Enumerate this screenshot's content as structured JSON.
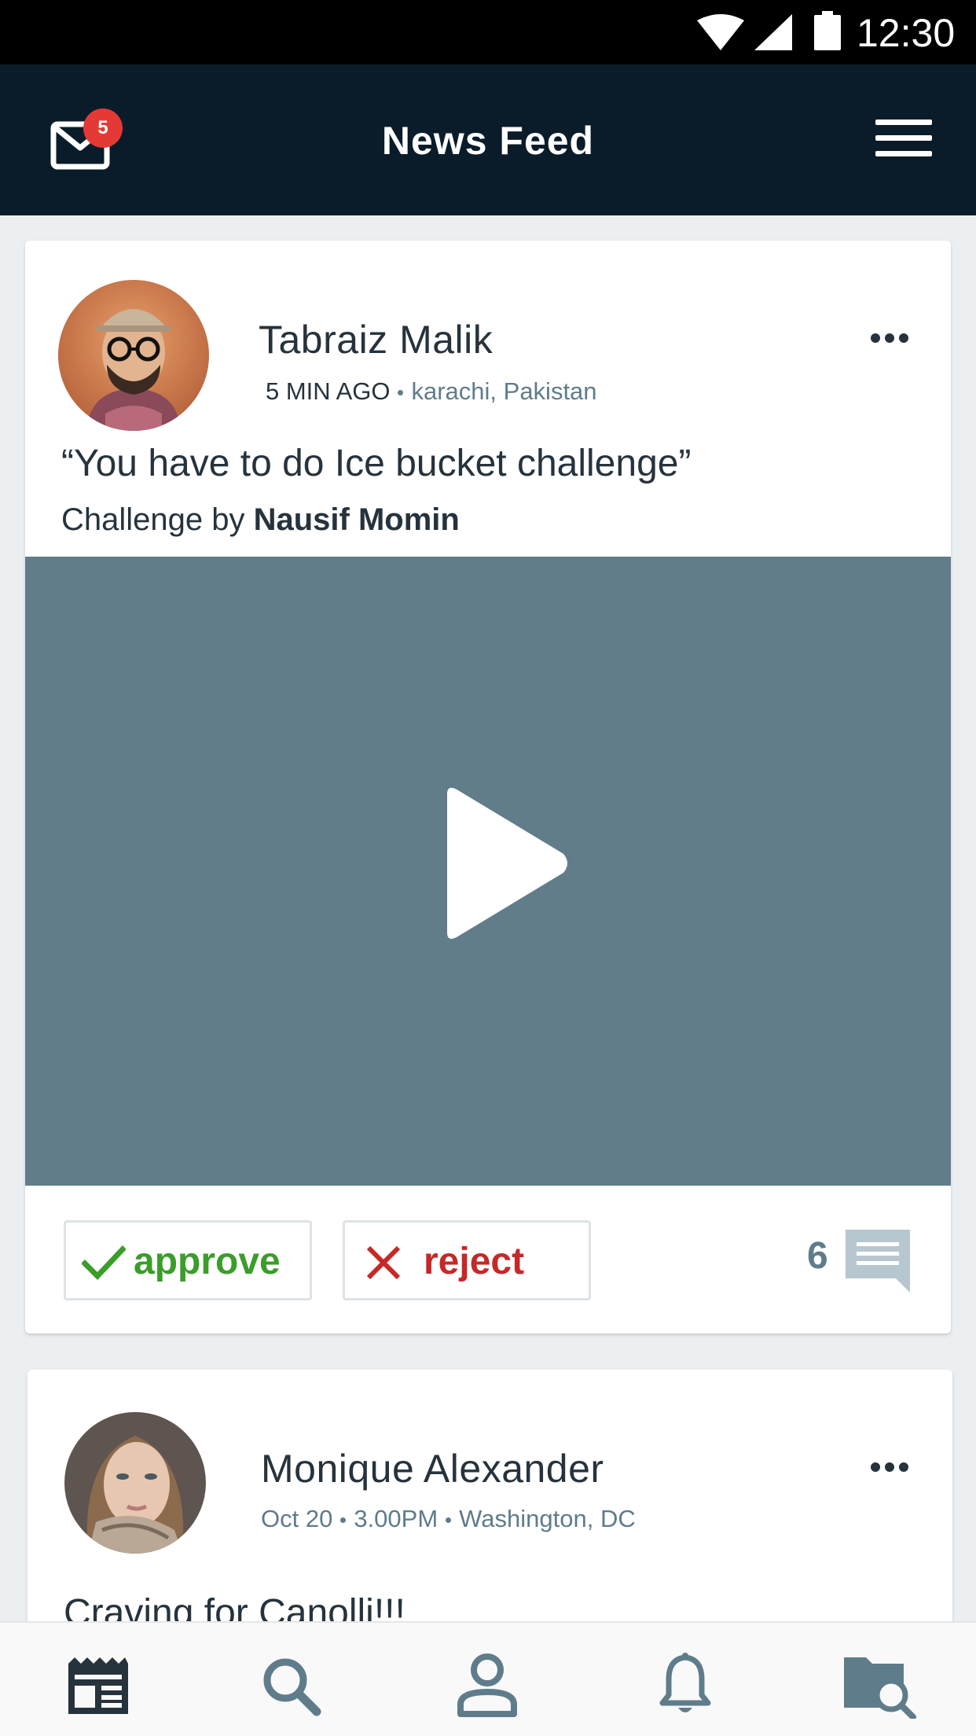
{
  "status_bar": {
    "time": "12:30"
  },
  "app_bar": {
    "title": "News Feed",
    "mail_badge_count": "5"
  },
  "posts": [
    {
      "author": "Tabraiz Malik",
      "time_ago": "5 MIN AGO",
      "location": "karachi, Pakistan",
      "quote": "“You have to do Ice bucket challenge”",
      "challenge_prefix": "Challenge by ",
      "challenger": "Nausif Momin",
      "approve_label": "approve",
      "reject_label": "reject",
      "comment_count": "6"
    },
    {
      "author": "Monique Alexander",
      "date": "Oct 20",
      "time": "3.00PM",
      "location": "Washington, DC",
      "text": "Craving for Canolli!!!"
    }
  ],
  "bottom_nav": [
    "news-feed-icon",
    "search-icon",
    "profile-icon",
    "bell-icon",
    "folder-search-icon"
  ],
  "colors": {
    "app_bar": "#0a1c2a",
    "video_placeholder": "#617d8a",
    "approve": "#3b9d2a",
    "reject": "#c62828",
    "badge": "#e53935",
    "text_dark": "#26333d",
    "text_muted": "#5f7c8a"
  }
}
